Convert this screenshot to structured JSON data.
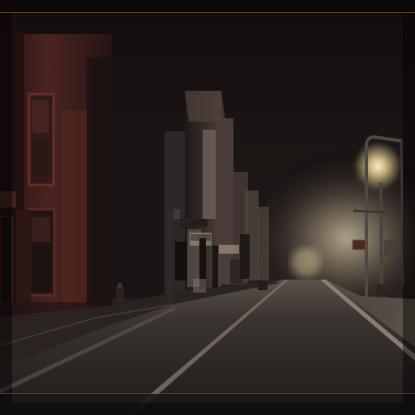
{
  "image": {
    "caption_text": "",
    "top_rule_color": "#735a3c",
    "bottom_rule_color": "#735a3c"
  },
  "scene": {
    "palette": {
      "sky": "#1c1716",
      "fog": "#b9b091",
      "road": "#2b2624",
      "building_left": "#3a1f1d",
      "lamp_glow": "#ffe7a7"
    }
  }
}
